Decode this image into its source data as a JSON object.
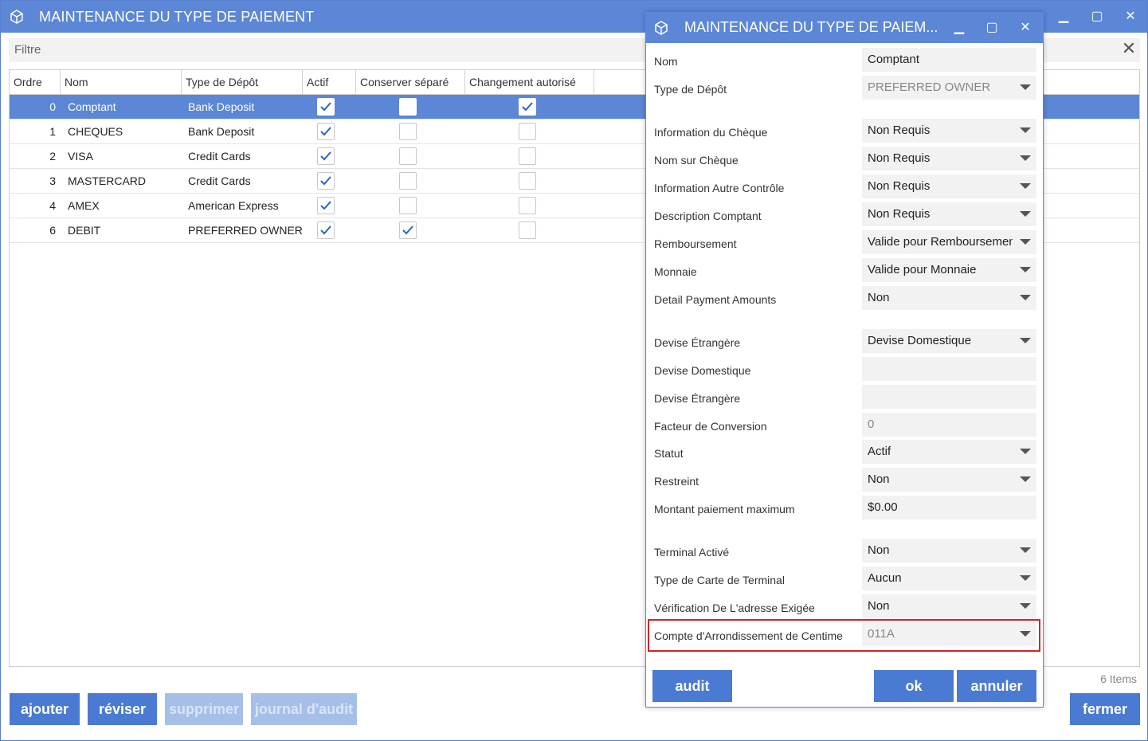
{
  "main": {
    "title": "MAINTENANCE DU TYPE DE PAIEMENT",
    "filter_label": "Filtre",
    "columns": [
      "Ordre",
      "Nom",
      "Type de Dépôt",
      "Actif",
      "Conserver séparé",
      "Changement autorisé"
    ],
    "rows": [
      {
        "ordre": "0",
        "nom": "Comptant",
        "type": "Bank Deposit",
        "actif": true,
        "separe": false,
        "changement": true
      },
      {
        "ordre": "1",
        "nom": "CHEQUES",
        "type": "Bank Deposit",
        "actif": true,
        "separe": false,
        "changement": false
      },
      {
        "ordre": "2",
        "nom": "VISA",
        "type": "Credit Cards",
        "actif": true,
        "separe": false,
        "changement": false
      },
      {
        "ordre": "3",
        "nom": "MASTERCARD",
        "type": "Credit Cards",
        "actif": true,
        "separe": false,
        "changement": false
      },
      {
        "ordre": "4",
        "nom": "AMEX",
        "type": "American Express",
        "actif": true,
        "separe": false,
        "changement": false
      },
      {
        "ordre": "6",
        "nom": "DEBIT",
        "type": "PREFERRED OWNER",
        "actif": true,
        "separe": true,
        "changement": false
      }
    ],
    "items_count": "6 Items",
    "buttons": {
      "ajouter": "ajouter",
      "reviser": "réviser",
      "supprimer": "supprimer",
      "journal": "journal d'audit",
      "fermer": "fermer"
    }
  },
  "dialog": {
    "title": "MAINTENANCE DU TYPE DE PAIEM...",
    "fields": {
      "nom": {
        "label": "Nom",
        "value": "Comptant"
      },
      "type_depot": {
        "label": "Type de Dépôt",
        "value": "PREFERRED OWNER"
      },
      "info_cheque": {
        "label": "Information du Chèque",
        "value": "Non Requis"
      },
      "nom_cheque": {
        "label": "Nom sur Chèque",
        "value": "Non Requis"
      },
      "info_autre": {
        "label": "Information Autre Contrôle",
        "value": "Non Requis"
      },
      "desc_comptant": {
        "label": "Description Comptant",
        "value": "Non Requis"
      },
      "remboursement": {
        "label": "Remboursement",
        "value": "Valide pour Remboursement"
      },
      "monnaie": {
        "label": "Monnaie",
        "value": "Valide pour Monnaie"
      },
      "detail_payment": {
        "label": "Detail Payment Amounts",
        "value": "Non"
      },
      "devise_etrangere_sel": {
        "label": "Devise Étrangère",
        "value": "Devise Domestique"
      },
      "devise_domestique": {
        "label": "Devise Domestique",
        "value": ""
      },
      "devise_etrangere": {
        "label": "Devise Étrangère",
        "value": ""
      },
      "facteur": {
        "label": "Facteur de Conversion",
        "value": "0"
      },
      "statut": {
        "label": "Statut",
        "value": "Actif"
      },
      "restreint": {
        "label": "Restreint",
        "value": "Non"
      },
      "montant_max": {
        "label": "Montant paiement maximum",
        "value": "$0.00"
      },
      "terminal_active": {
        "label": "Terminal Activé",
        "value": "Non"
      },
      "type_carte": {
        "label": "Type de Carte de Terminal",
        "value": "Aucun"
      },
      "verification": {
        "label": "Vérification De L'adresse Exigée",
        "value": "Non"
      },
      "compte_arrondi": {
        "label": "Compte d'Arrondissement de Centime",
        "value": "011A"
      }
    },
    "buttons": {
      "audit": "audit",
      "ok": "ok",
      "annuler": "annuler"
    }
  },
  "colors": {
    "accent": "#5b87d6",
    "button": "#4a7ad1",
    "highlight": "#d2232a"
  }
}
